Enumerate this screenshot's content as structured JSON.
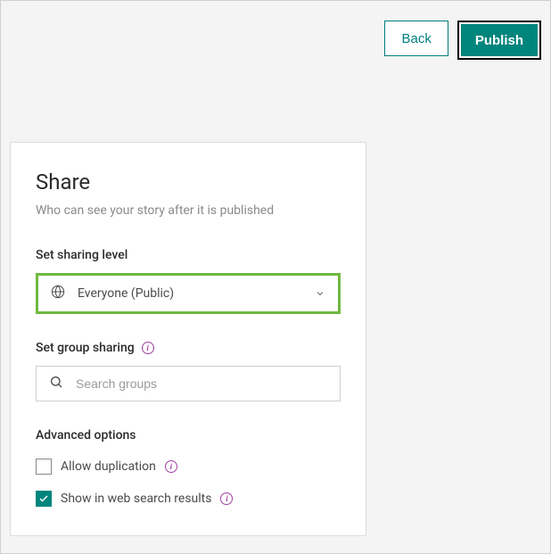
{
  "header": {
    "back_label": "Back",
    "publish_label": "Publish"
  },
  "panel": {
    "title": "Share",
    "subtitle": "Who can see your story after it is published",
    "sharing_level": {
      "label": "Set sharing level",
      "selected": "Everyone (Public)"
    },
    "group_sharing": {
      "label": "Set group sharing",
      "placeholder": "Search groups"
    },
    "advanced": {
      "title": "Advanced options",
      "allow_duplication": {
        "label": "Allow duplication",
        "checked": false
      },
      "show_in_search": {
        "label": "Show in web search results",
        "checked": true
      }
    }
  }
}
